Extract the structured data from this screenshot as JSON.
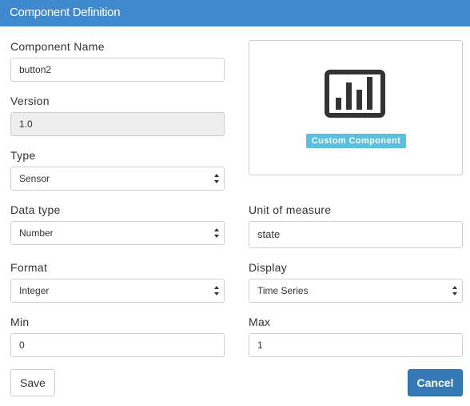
{
  "header": {
    "title": "Component Definition"
  },
  "form": {
    "component_name": {
      "label": "Component Name",
      "value": "button2"
    },
    "version": {
      "label": "Version",
      "value": "1.0"
    },
    "type": {
      "label": "Type",
      "value": "Sensor"
    },
    "data_type": {
      "label": "Data type",
      "value": "Number"
    },
    "unit_of_measure": {
      "label": "Unit of measure",
      "value": "state"
    },
    "format": {
      "label": "Format",
      "value": "Integer"
    },
    "display": {
      "label": "Display",
      "value": "Time Series"
    },
    "min": {
      "label": "Min",
      "value": "0"
    },
    "max": {
      "label": "Max",
      "value": "1"
    }
  },
  "preview": {
    "icon": "bar-chart-icon",
    "badge": "Custom Component",
    "badge_color": "#5bc0de"
  },
  "buttons": {
    "save": "Save",
    "cancel": "Cancel"
  },
  "colors": {
    "header": "#3f89cf",
    "primary": "#337ab7"
  }
}
